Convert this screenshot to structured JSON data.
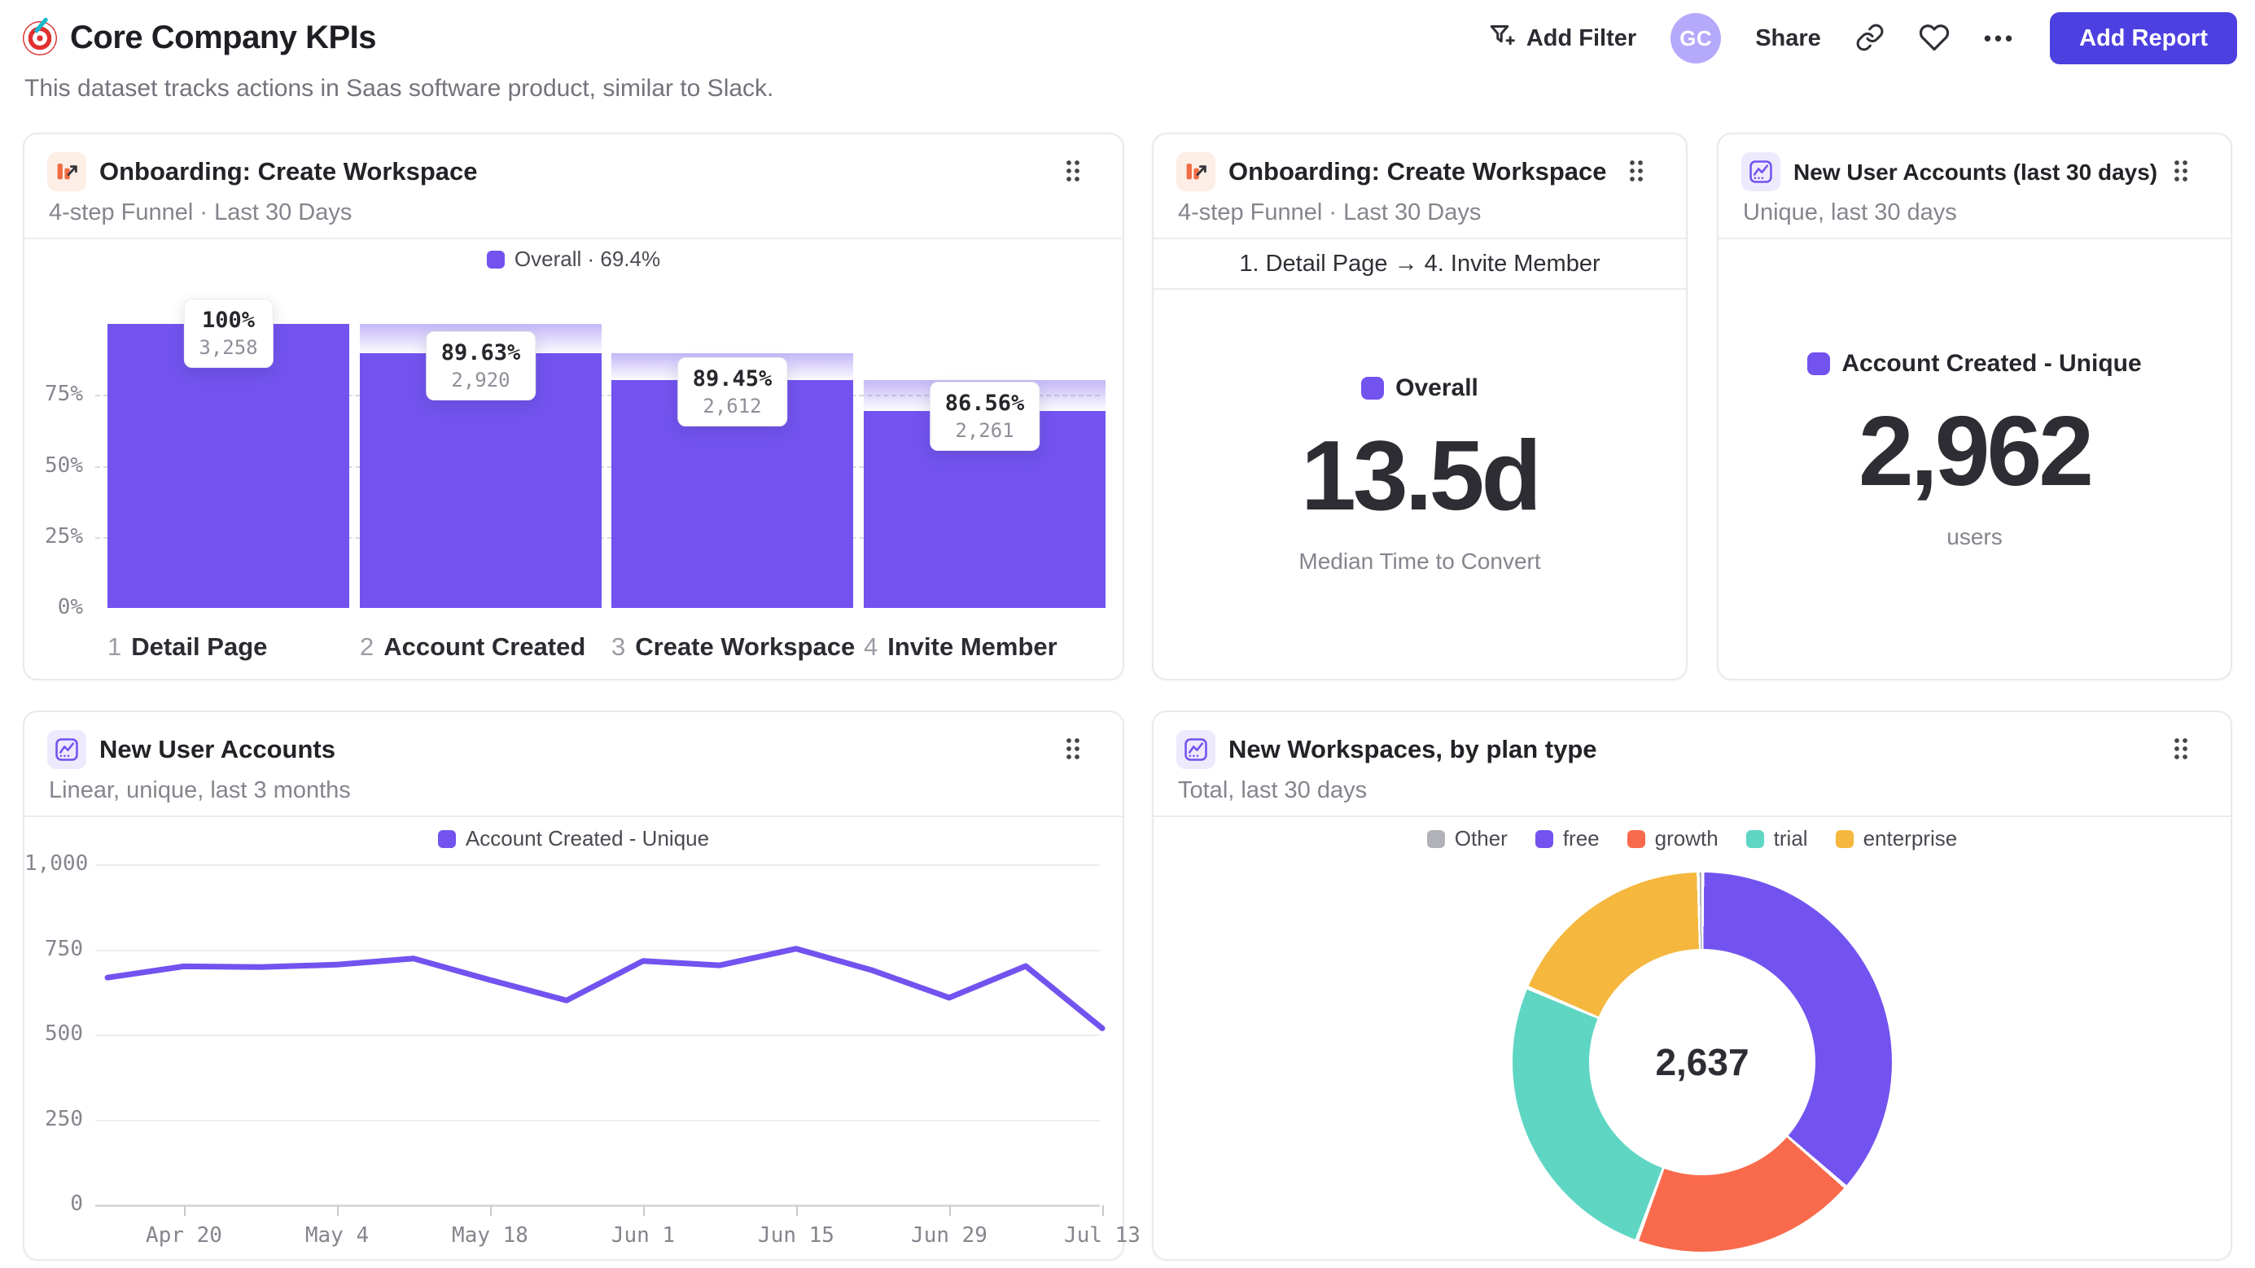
{
  "page": {
    "title": "Core Company KPIs",
    "subtitle": "This dataset tracks actions in Saas software product, similar to Slack."
  },
  "header": {
    "add_filter": "Add Filter",
    "avatar_initials": "GC",
    "share": "Share",
    "ellipsis": "•••",
    "add_report": "Add Report"
  },
  "icons": {
    "page_title": "target-icon",
    "add_filter": "filter-plus-icon",
    "link": "link-icon",
    "favorite": "heart-icon",
    "more": "ellipsis-icon",
    "drag": "drag-handle-icon",
    "funnel_report": "funnel-chart-icon",
    "insights_report": "line-chart-icon"
  },
  "colors": {
    "accent_purple": "#7253ef",
    "coral": "#f96a4c",
    "teal": "#5fd6c3",
    "amber": "#f5b73e",
    "gray": "#b1b1b8",
    "button_indigo": "#4c40e0",
    "avatar_bg": "#b5a9fc"
  },
  "cards": {
    "funnel": {
      "title": "Onboarding: Create Workspace",
      "subtitle": "4-step Funnel · Last 30 Days"
    },
    "time_to_convert": {
      "title": "Onboarding: Create Workspace",
      "subtitle": "4-step Funnel · Last 30 Days",
      "filter_label": "1. Detail Page → 4. Invite Member"
    },
    "new_users_30d": {
      "title": "New User Accounts (last 30 days)",
      "subtitle": "Unique, last 30 days"
    },
    "new_users_line": {
      "title": "New User Accounts",
      "subtitle": "Linear, unique, last 3 months"
    },
    "workspaces_donut": {
      "title": "New Workspaces, by plan type",
      "subtitle": "Total, last 30 days"
    }
  },
  "chart_data": [
    {
      "type": "funnel_bar",
      "title": "Onboarding: Create Workspace",
      "legend": "Overall · 69.4%",
      "steps": [
        {
          "num": "1",
          "label": "Detail Page"
        },
        {
          "num": "2",
          "label": "Account Created"
        },
        {
          "num": "3",
          "label": "Create Workspace"
        },
        {
          "num": "4",
          "label": "Invite Member"
        }
      ],
      "values": [
        3258,
        2920,
        2612,
        2261
      ],
      "value_labels": [
        "3,258",
        "2,920",
        "2,612",
        "2,261"
      ],
      "pct_labels": [
        "100%",
        "89.63%",
        "89.45%",
        "86.56%"
      ],
      "yticks": [
        "0%",
        "25%",
        "50%",
        "75%"
      ],
      "ylim": [
        0,
        100
      ],
      "bar_color": "#7253ef"
    },
    {
      "type": "metric",
      "legend": "Overall",
      "value": "13.5d",
      "caption": "Median Time to Convert"
    },
    {
      "type": "metric",
      "legend": "Account Created - Unique",
      "value": "2,962",
      "caption": "users"
    },
    {
      "type": "line",
      "legend": "Account Created - Unique",
      "x": [
        "Apr 13",
        "Apr 20",
        "Apr 27",
        "May 4",
        "May 11",
        "May 18",
        "May 25",
        "Jun 1",
        "Jun 8",
        "Jun 15",
        "Jun 22",
        "Jun 29",
        "Jul 6",
        "Jul 13"
      ],
      "values": [
        667,
        700,
        698,
        705,
        723,
        660,
        600,
        716,
        703,
        752,
        688,
        608,
        701,
        518
      ],
      "xticks": [
        "Apr 20",
        "May 4",
        "May 18",
        "Jun 1",
        "Jun 15",
        "Jun 29",
        "Jul 13"
      ],
      "yticks": [
        "0",
        "250",
        "500",
        "750",
        "1,000"
      ],
      "ylim": [
        0,
        1050
      ],
      "line_color": "#7253ef"
    },
    {
      "type": "donut",
      "center_label": "2,637",
      "total": 2637,
      "slices": [
        {
          "label": "Other",
          "value": 8,
          "color": "#b1b1b8"
        },
        {
          "label": "free",
          "value": 960,
          "color": "#7253ef"
        },
        {
          "label": "growth",
          "value": 506,
          "color": "#f96a4c"
        },
        {
          "label": "trial",
          "value": 681,
          "color": "#5fd6c3"
        },
        {
          "label": "enterprise",
          "value": 482,
          "color": "#f5b73e"
        }
      ],
      "draw_order": [
        1,
        2,
        3,
        4,
        0
      ]
    }
  ]
}
